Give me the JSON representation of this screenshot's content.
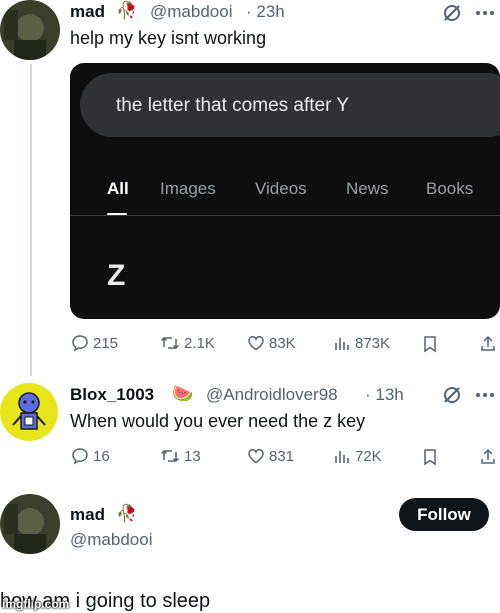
{
  "tweet1": {
    "name": "mad",
    "emoji": "🥀",
    "handle": "@mabdooi",
    "time": "· 23h",
    "text": "help my  key isnt working",
    "media": {
      "search_query": "the letter that comes after Y",
      "tabs": [
        "All",
        "Images",
        "Videos",
        "News",
        "Books"
      ],
      "active_tab": "All",
      "result": "Z"
    },
    "actions": {
      "replies": "215",
      "reposts": "2.1K",
      "likes": "83K",
      "views": "873K"
    }
  },
  "tweet2": {
    "name": "Blox_1003",
    "emoji": "🍉",
    "handle": "@Androidlover98",
    "time": "· 13h",
    "text": "When would you ever need the z key",
    "actions": {
      "replies": "16",
      "reposts": "13",
      "likes": "831",
      "views": "72K"
    }
  },
  "profile": {
    "name": "mad",
    "emoji": "🥀",
    "handle": "@mabdooi",
    "follow_label": "Follow"
  },
  "caption": "how am i going to sleep",
  "watermark": "imgflip.com",
  "colors": {
    "grok_icon": "#536471",
    "follow_bg": "#0f1419",
    "google_bg": "#0e0e10",
    "search_pill": "#303134"
  }
}
